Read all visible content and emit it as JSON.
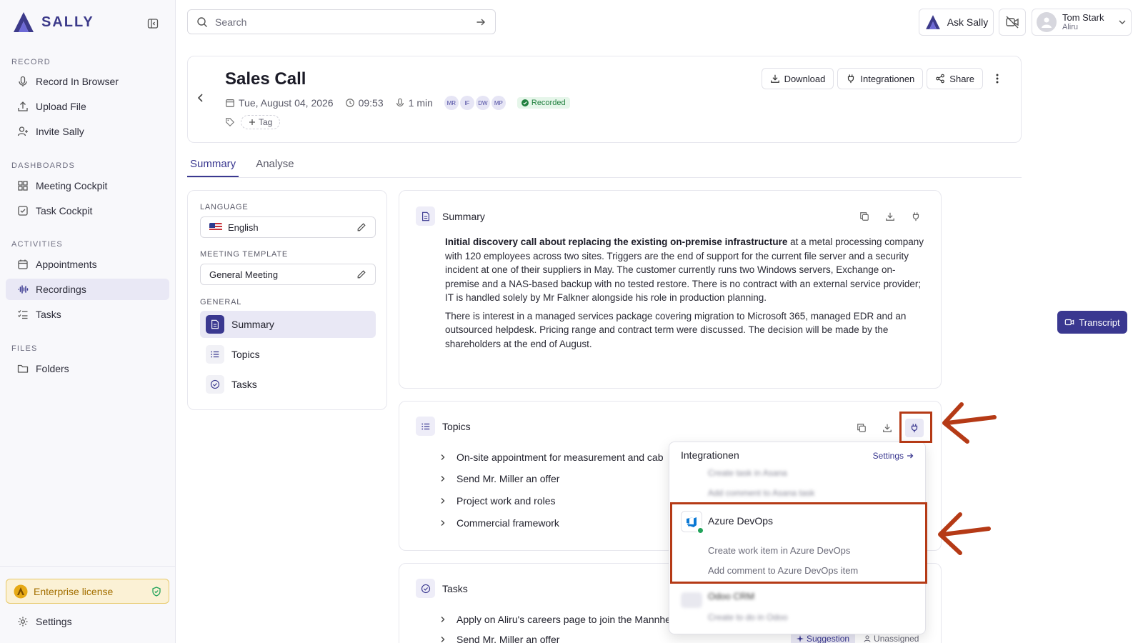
{
  "sidebar": {
    "logo": "SALLY",
    "sections": [
      {
        "label": "RECORD",
        "items": [
          {
            "label": "Record In Browser",
            "icon": "mic-icon"
          },
          {
            "label": "Upload File",
            "icon": "upload-icon"
          },
          {
            "label": "Invite Sally",
            "icon": "user-plus-icon"
          }
        ]
      },
      {
        "label": "DASHBOARDS",
        "items": [
          {
            "label": "Meeting Cockpit",
            "icon": "grid-icon"
          },
          {
            "label": "Task Cockpit",
            "icon": "checkbox-icon"
          }
        ]
      },
      {
        "label": "ACTIVITIES",
        "items": [
          {
            "label": "Appointments",
            "icon": "calendar-icon"
          },
          {
            "label": "Recordings",
            "icon": "waveform-icon"
          },
          {
            "label": "Tasks",
            "icon": "list-check-icon"
          }
        ]
      },
      {
        "label": "FILES",
        "items": [
          {
            "label": "Folders",
            "icon": "folder-icon"
          }
        ]
      }
    ],
    "active_item": "Recordings",
    "enterprise_label": "Enterprise license",
    "settings_label": "Settings"
  },
  "topbar": {
    "search_placeholder": "Search",
    "ask_label": "Ask Sally",
    "user_name": "Tom Stark",
    "user_org": "Aliru"
  },
  "meeting": {
    "title": "Sales Call",
    "date": "Tue, August 04, 2026",
    "time": "09:53",
    "duration": "1 min",
    "participants": [
      "MR",
      "IF",
      "DW",
      "MP"
    ],
    "status": "Recorded",
    "tag_label": "Tag",
    "buttons": {
      "download": "Download",
      "integrations": "Integrationen",
      "share": "Share"
    }
  },
  "tabs": [
    "Summary",
    "Analyse"
  ],
  "config": {
    "language_label": "LANGUAGE",
    "language_value": "English",
    "template_label": "MEETING TEMPLATE",
    "template_value": "General Meeting",
    "general_label": "GENERAL",
    "general_items": [
      "Summary",
      "Topics",
      "Tasks"
    ]
  },
  "summary": {
    "title": "Summary",
    "p1_bold": "Initial discovery call about replacing the existing on-premise infrastructure",
    "p1_rest": " at a metal processing company with 120 employees across two sites. Triggers are the end of support for the current file server and a security incident at one of their suppliers in May. The customer currently runs two Windows servers, Exchange on-premise and a NAS-based backup with no tested restore. There is no contract with an external service provider; IT is handled solely by Mr Falkner alongside his role in production planning.",
    "p2": "There is interest in a managed services package covering migration to Microsoft 365, managed EDR and an outsourced helpdesk. Pricing range and contract term were discussed. The decision will be made by the shareholders at the end of August."
  },
  "topics": {
    "title": "Topics",
    "items": [
      "On-site appointment for measurement and cab",
      "Send Mr. Miller an offer",
      "Project work and roles",
      "Commercial framework"
    ]
  },
  "tasks": {
    "title": "Tasks",
    "items": [
      "Apply on Aliru's careers page to join the Mannhe",
      "Send Mr. Miller an offer"
    ],
    "badge_suggestion": "Suggestion",
    "badge_unassigned": "Unassigned"
  },
  "transcript_label": "Transcript",
  "integrations": {
    "header": "Integrationen",
    "settings_label": "Settings",
    "blurred_top": [
      "Create task in Asana",
      "Add comment to Asana task"
    ],
    "featured": {
      "name": "Azure DevOps",
      "actions": [
        "Create work item in Azure DevOps",
        "Add comment to Azure DevOps item"
      ]
    },
    "blurred_bottom": {
      "name": "Odoo CRM",
      "action": "Create to do in Odoo"
    }
  },
  "colors": {
    "brand": "#3a3890",
    "annotation": "#b53a16",
    "success": "#22a35a",
    "enterprise_bg": "#fbf1d5"
  }
}
